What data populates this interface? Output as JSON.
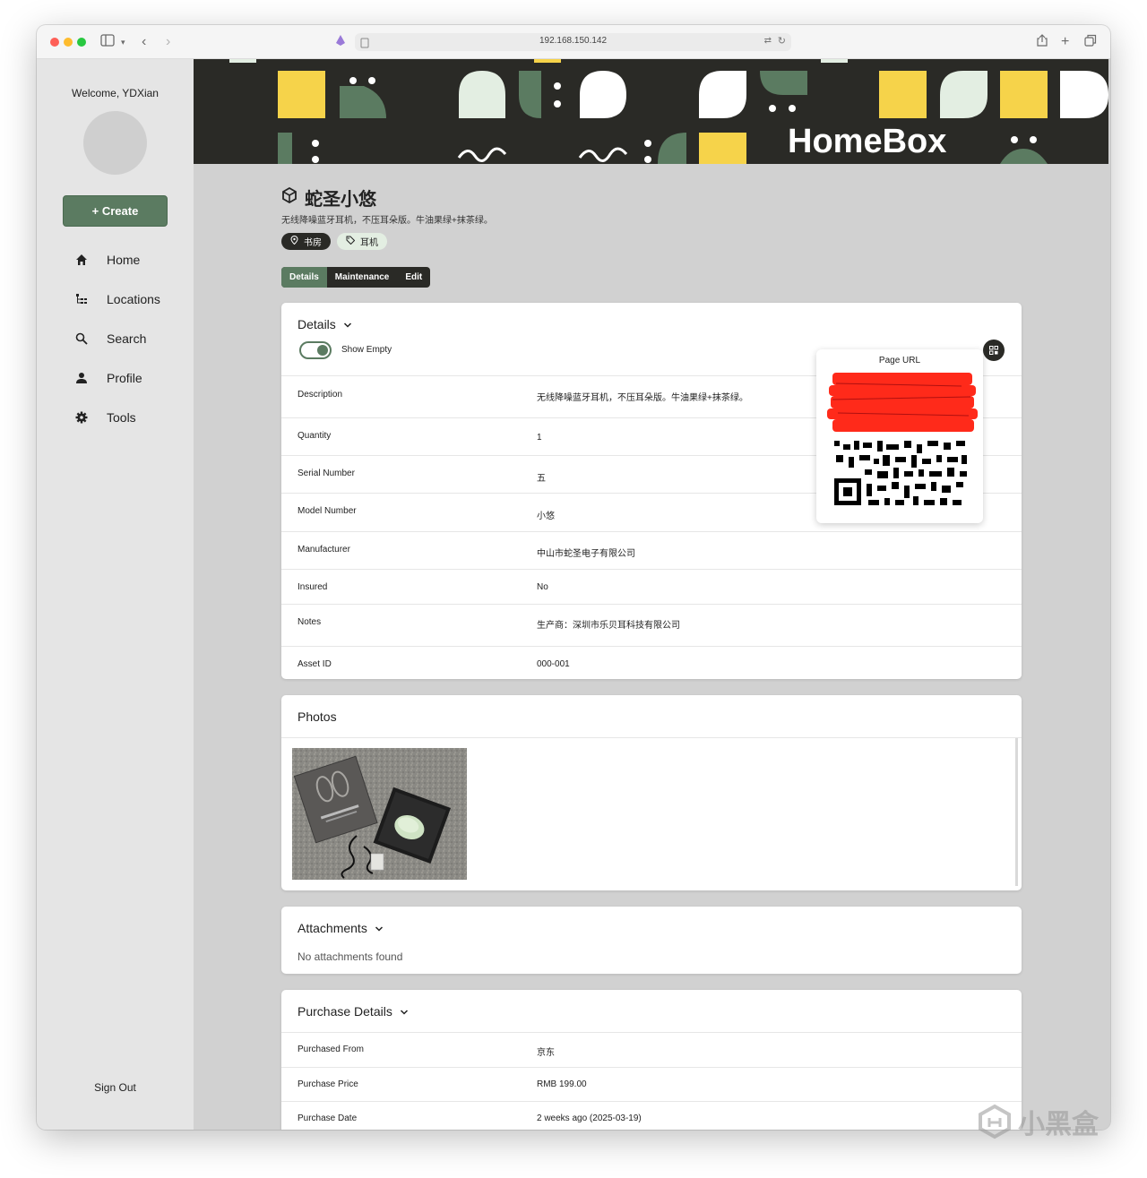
{
  "browser": {
    "url": "192.168.150.142"
  },
  "sidebar": {
    "welcome": "Welcome, YDXian",
    "create_label": "+ Create",
    "items": [
      {
        "label": "Home",
        "icon": "home-icon"
      },
      {
        "label": "Locations",
        "icon": "locations-icon"
      },
      {
        "label": "Search",
        "icon": "search-icon"
      },
      {
        "label": "Profile",
        "icon": "profile-icon"
      },
      {
        "label": "Tools",
        "icon": "gear-icon"
      }
    ],
    "sign_out": "Sign Out"
  },
  "banner": {
    "brand": "HomeBox"
  },
  "item": {
    "title": "蛇圣小悠",
    "subtitle": "无线降噪蓝牙耳机，不压耳朵版。牛油果绿+抹茶绿。",
    "location_tag": "书房",
    "label_tag": "耳机"
  },
  "tabs": [
    "Details",
    "Maintenance",
    "Edit"
  ],
  "details": {
    "heading": "Details",
    "show_empty_label": "Show Empty",
    "qr_label": "Page URL",
    "rows": [
      {
        "key": "Description",
        "value": "无线降噪蓝牙耳机，不压耳朵版。牛油果绿+抹茶绿。"
      },
      {
        "key": "Quantity",
        "value": "1"
      },
      {
        "key": "Serial Number",
        "value": "五"
      },
      {
        "key": "Model Number",
        "value": "小悠"
      },
      {
        "key": "Manufacturer",
        "value": "中山市蛇圣电子有限公司"
      },
      {
        "key": "Insured",
        "value": "No"
      },
      {
        "key": "Notes",
        "value": "生产商：深圳市乐贝耳科技有限公司"
      },
      {
        "key": "Asset ID",
        "value": "000-001"
      }
    ]
  },
  "photos": {
    "heading": "Photos"
  },
  "attachments": {
    "heading": "Attachments",
    "empty_text": "No attachments found"
  },
  "purchase": {
    "heading": "Purchase Details",
    "rows": [
      {
        "key": "Purchased From",
        "value": "京东"
      },
      {
        "key": "Purchase Price",
        "value": "RMB 199.00"
      },
      {
        "key": "Purchase Date",
        "value": "2 weeks ago (2025-03-19)"
      }
    ]
  },
  "watermark": "小黑盒",
  "colors": {
    "accent": "#5b7b61",
    "banner_bg": "#2a2a26",
    "banner_yellow": "#f6d34a",
    "banner_mint": "#e3eee2",
    "banner_green": "#5b7b61"
  }
}
